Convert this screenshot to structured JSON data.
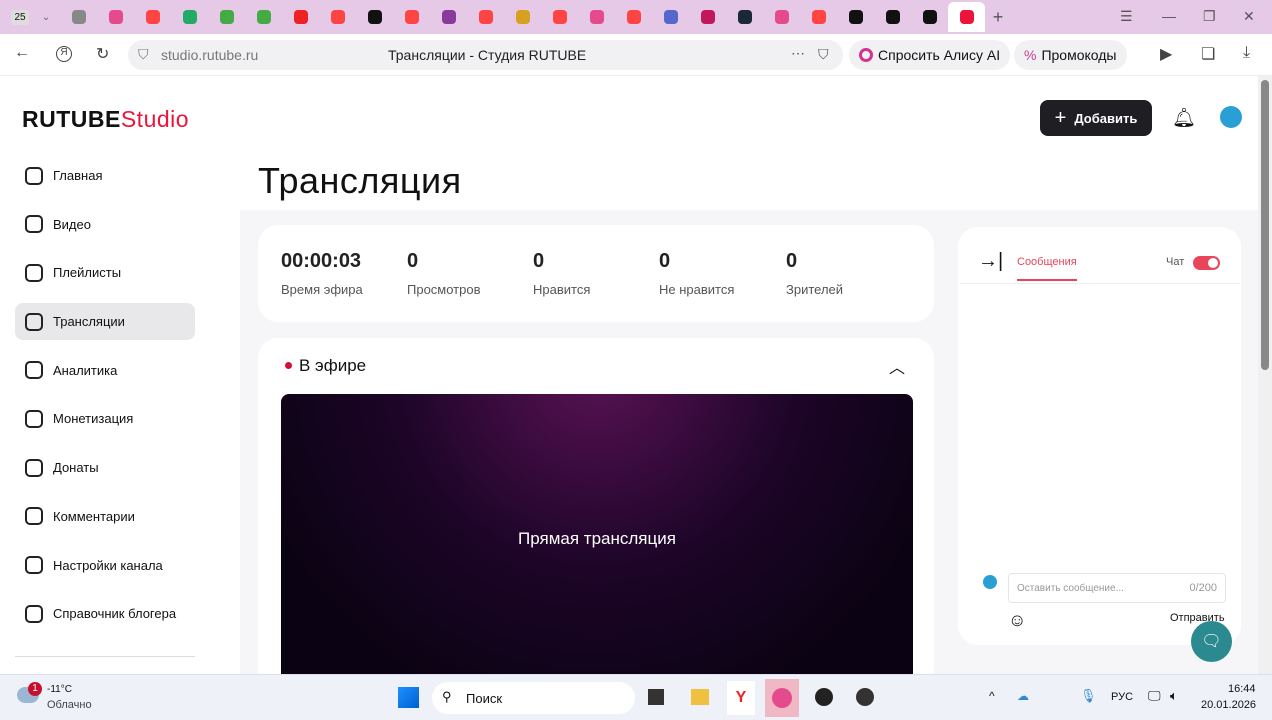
{
  "browser": {
    "tab_count": "25",
    "tab_icons": [
      {
        "name": "doc",
        "color": "#888"
      },
      {
        "name": "pink",
        "color": "#e54b8c"
      },
      {
        "name": "yandex",
        "color": "#f44"
      },
      {
        "name": "s-green",
        "color": "#2a6"
      },
      {
        "name": "shield",
        "color": "#4a4"
      },
      {
        "name": "shield",
        "color": "#4a4"
      },
      {
        "name": "youtube",
        "color": "#e22"
      },
      {
        "name": "yandex",
        "color": "#f44"
      },
      {
        "name": "rutube",
        "color": "#111"
      },
      {
        "name": "yandex",
        "color": "#f44"
      },
      {
        "name": "purple",
        "color": "#8a3a9a"
      },
      {
        "name": "yandex",
        "color": "#f44"
      },
      {
        "name": "image",
        "color": "#d8a020"
      },
      {
        "name": "yandex",
        "color": "#f44"
      },
      {
        "name": "pink",
        "color": "#e54b8c"
      },
      {
        "name": "yandex",
        "color": "#f44"
      },
      {
        "name": "pen",
        "color": "#56c"
      },
      {
        "name": "s-red",
        "color": "#c2185b"
      },
      {
        "name": "steam",
        "color": "#1b2838"
      },
      {
        "name": "pink",
        "color": "#e54b8c"
      },
      {
        "name": "yandex",
        "color": "#f44"
      },
      {
        "name": "rutube",
        "color": "#111"
      },
      {
        "name": "rutube",
        "color": "#111"
      },
      {
        "name": "rutube",
        "color": "#111"
      },
      {
        "name": "studio",
        "color": "#ed143b"
      }
    ],
    "url": "studio.rutube.ru",
    "page_title": "Трансляции - Студия RUTUBE",
    "alice": "Спросить Алису AI",
    "promo": "Промокоды"
  },
  "header": {
    "logo_main": "RUTUBE",
    "logo_studio": "Studio",
    "add_label": "Добавить"
  },
  "sidebar": {
    "items": [
      {
        "label": "Главная",
        "icon": "home-icon"
      },
      {
        "label": "Видео",
        "icon": "video-icon"
      },
      {
        "label": "Плейлисты",
        "icon": "playlist-icon"
      },
      {
        "label": "Трансляции",
        "icon": "broadcast-icon",
        "active": true
      },
      {
        "label": "Аналитика",
        "icon": "analytics-icon"
      },
      {
        "label": "Монетизация",
        "icon": "ruble-icon"
      },
      {
        "label": "Донаты",
        "icon": "wallet-icon"
      },
      {
        "label": "Комментарии",
        "icon": "comment-icon"
      },
      {
        "label": "Настройки канала",
        "icon": "gear-icon"
      },
      {
        "label": "Справочник блогера",
        "icon": "info-icon"
      }
    ]
  },
  "main": {
    "title": "Трансляция",
    "stats": [
      {
        "value": "00:00:03",
        "label": "Время эфира"
      },
      {
        "value": "0",
        "label": "Просмотров"
      },
      {
        "value": "0",
        "label": "Нравится"
      },
      {
        "value": "0",
        "label": "Не нравится"
      },
      {
        "value": "0",
        "label": "Зрителей"
      }
    ],
    "live_label": "В эфире",
    "player_text": "Прямая трансляция"
  },
  "chat": {
    "tab": "Сообщения",
    "toggle_label": "Чат",
    "toggle_on": true,
    "placeholder": "Оставить сообщение...",
    "counter": "0/200",
    "send": "Отправить",
    "accent": "#e8455a"
  },
  "taskbar": {
    "weather_badge": "1",
    "temp": "-11°C",
    "weather": "Облачно",
    "search": "Поиск",
    "lang": "РУС",
    "time": "16:44",
    "date": "20.01.2026"
  }
}
